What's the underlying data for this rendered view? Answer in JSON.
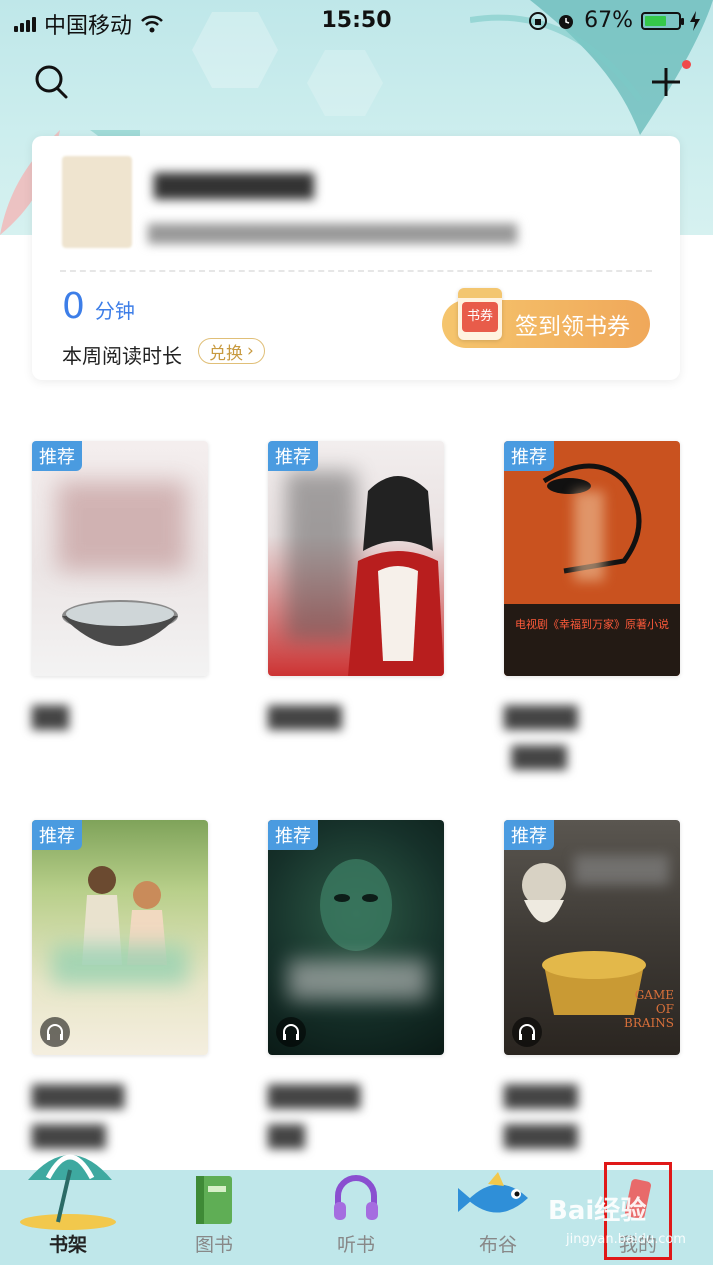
{
  "status_bar": {
    "carrier": "中国移动",
    "time": "15:50",
    "battery": "67%",
    "battery_level": 0.67
  },
  "reading_card": {
    "minutes_value": "0",
    "minutes_unit": "分钟",
    "week_label": "本周阅读时长",
    "exchange_label": "兑换",
    "checkin_label": "签到领书券",
    "coupon_text": "书券"
  },
  "tag_label": "推荐",
  "books": [
    {
      "tag": "推荐",
      "audio": false
    },
    {
      "tag": "推荐",
      "audio": false
    },
    {
      "tag": "推荐",
      "audio": false,
      "cover_caption": "电视剧《幸福到万家》原著小说"
    },
    {
      "tag": "推荐",
      "audio": true
    },
    {
      "tag": "推荐",
      "audio": true
    },
    {
      "tag": "推荐",
      "audio": true,
      "cover_caption": "GAME OF BRAINS"
    }
  ],
  "tabbar": {
    "items": [
      {
        "label": "书架"
      },
      {
        "label": "图书"
      },
      {
        "label": "听书"
      },
      {
        "label": "布谷"
      },
      {
        "label": "我的"
      }
    ]
  },
  "watermark": {
    "main": "Bai经验",
    "sub": "jingyan.baidu.com"
  },
  "colors": {
    "accent": "#3d7ee8",
    "tag": "#4a9be0",
    "checkin": "#f0a85a",
    "tabbar": "#bfe7ea"
  }
}
